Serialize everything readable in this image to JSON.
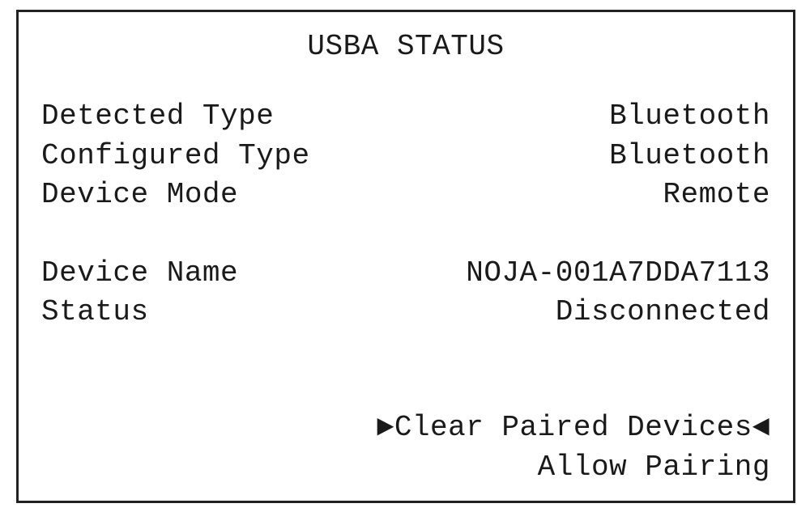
{
  "title": "USBA STATUS",
  "rows": {
    "detected_type": {
      "label": "Detected Type",
      "value": "Bluetooth"
    },
    "configured_type": {
      "label": "Configured Type",
      "value": "Bluetooth"
    },
    "device_mode": {
      "label": "Device Mode",
      "value": "Remote"
    },
    "device_name": {
      "label": "Device Name",
      "value": "NOJA-001A7DDA7113"
    },
    "status": {
      "label": "Status",
      "value": "Disconnected"
    }
  },
  "actions": {
    "clear_paired": "Clear Paired Devices",
    "allow_pairing": "Allow Pairing"
  },
  "markers": {
    "left": "►",
    "right": "◄"
  }
}
